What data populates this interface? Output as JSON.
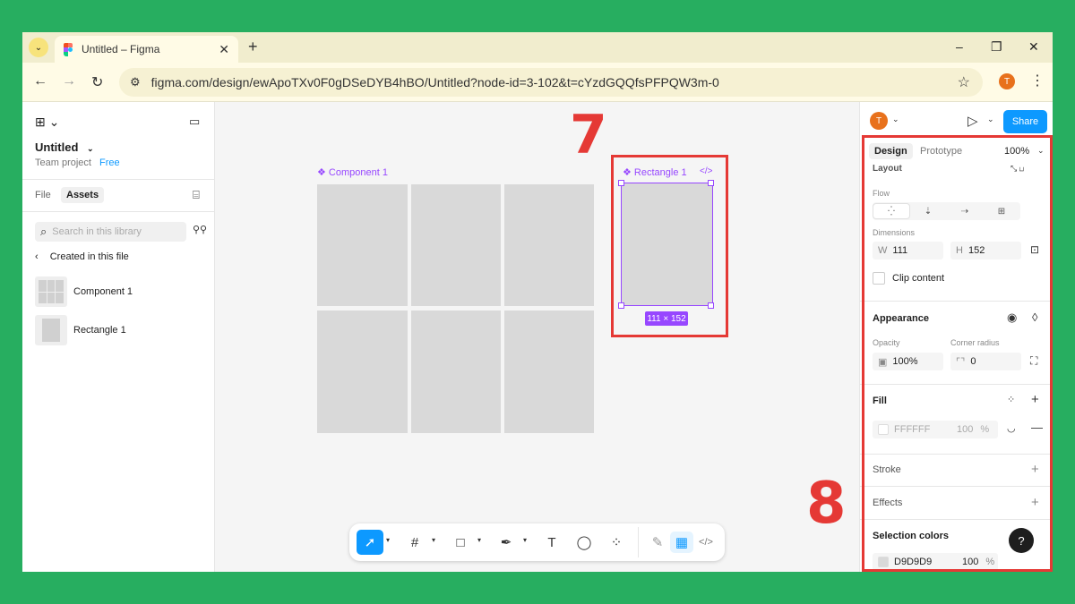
{
  "browser": {
    "tab_title": "Untitled – Figma",
    "close": "✕",
    "new_tab": "+",
    "url": "figma.com/design/ewApoTXv0F0gDSeDYB4hBO/Untitled?node-id=3-102&t=cYzdGQQfsPFPQW3m-0",
    "profile_initial": "T",
    "window_controls": [
      "–",
      "❐",
      "✕"
    ]
  },
  "left_panel": {
    "file_name": "Untitled",
    "team": "Team project",
    "plan_badge": "Free",
    "tabs": [
      "File",
      "Assets"
    ],
    "search_placeholder": "Search in this library",
    "section": "Created in this file",
    "assets": [
      {
        "name": "Component 1"
      },
      {
        "name": "Rectangle 1"
      }
    ]
  },
  "canvas": {
    "component_label": "❖ Component 1",
    "rectangle_label": "❖ Rectangle 1",
    "code_icon": "</>",
    "dimension_badge": "111 × 152",
    "fill_color": "#d9d9d9",
    "selection_color": "#9747ff"
  },
  "annotations": {
    "num7": "7",
    "num8": "8",
    "color": "#e53935"
  },
  "toolbar": {
    "tools": [
      "move-tool",
      "frame-tool",
      "shape-tool",
      "pen-tool",
      "text-tool",
      "comment-tool",
      "actions-tool",
      "draw-mode",
      "design-mode",
      "dev-mode"
    ]
  },
  "right_panel": {
    "avatar_initial": "T",
    "share_label": "Share",
    "tabs": [
      "Design",
      "Prototype"
    ],
    "zoom": "100%",
    "layout": "Layout",
    "flow": "Flow",
    "dimensions": "Dimensions",
    "w_label": "W",
    "w_value": "111",
    "h_label": "H",
    "h_value": "152",
    "clip_content": "Clip content",
    "appearance": "Appearance",
    "opacity_label": "Opacity",
    "opacity_value": "100%",
    "corner_label": "Corner radius",
    "corner_value": "0",
    "fill": "Fill",
    "fill_hex": "FFFFFF",
    "fill_opacity": "100",
    "percent": "%",
    "stroke": "Stroke",
    "effects": "Effects",
    "selection_colors": "Selection colors",
    "sel_hex": "D9D9D9",
    "sel_opacity": "100",
    "help": "?"
  }
}
